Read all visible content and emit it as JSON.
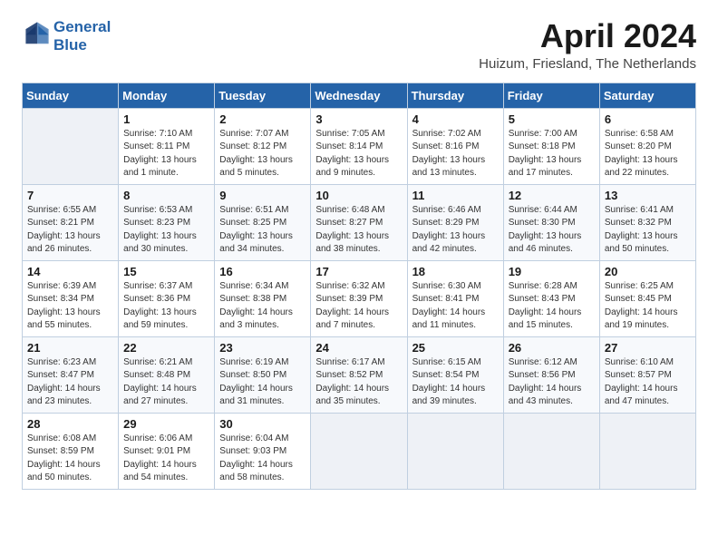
{
  "header": {
    "logo_line1": "General",
    "logo_line2": "Blue",
    "title": "April 2024",
    "subtitle": "Huizum, Friesland, The Netherlands"
  },
  "days_of_week": [
    "Sunday",
    "Monday",
    "Tuesday",
    "Wednesday",
    "Thursday",
    "Friday",
    "Saturday"
  ],
  "weeks": [
    [
      {
        "day": "",
        "info": ""
      },
      {
        "day": "1",
        "info": "Sunrise: 7:10 AM\nSunset: 8:11 PM\nDaylight: 13 hours\nand 1 minute."
      },
      {
        "day": "2",
        "info": "Sunrise: 7:07 AM\nSunset: 8:12 PM\nDaylight: 13 hours\nand 5 minutes."
      },
      {
        "day": "3",
        "info": "Sunrise: 7:05 AM\nSunset: 8:14 PM\nDaylight: 13 hours\nand 9 minutes."
      },
      {
        "day": "4",
        "info": "Sunrise: 7:02 AM\nSunset: 8:16 PM\nDaylight: 13 hours\nand 13 minutes."
      },
      {
        "day": "5",
        "info": "Sunrise: 7:00 AM\nSunset: 8:18 PM\nDaylight: 13 hours\nand 17 minutes."
      },
      {
        "day": "6",
        "info": "Sunrise: 6:58 AM\nSunset: 8:20 PM\nDaylight: 13 hours\nand 22 minutes."
      }
    ],
    [
      {
        "day": "7",
        "info": "Sunrise: 6:55 AM\nSunset: 8:21 PM\nDaylight: 13 hours\nand 26 minutes."
      },
      {
        "day": "8",
        "info": "Sunrise: 6:53 AM\nSunset: 8:23 PM\nDaylight: 13 hours\nand 30 minutes."
      },
      {
        "day": "9",
        "info": "Sunrise: 6:51 AM\nSunset: 8:25 PM\nDaylight: 13 hours\nand 34 minutes."
      },
      {
        "day": "10",
        "info": "Sunrise: 6:48 AM\nSunset: 8:27 PM\nDaylight: 13 hours\nand 38 minutes."
      },
      {
        "day": "11",
        "info": "Sunrise: 6:46 AM\nSunset: 8:29 PM\nDaylight: 13 hours\nand 42 minutes."
      },
      {
        "day": "12",
        "info": "Sunrise: 6:44 AM\nSunset: 8:30 PM\nDaylight: 13 hours\nand 46 minutes."
      },
      {
        "day": "13",
        "info": "Sunrise: 6:41 AM\nSunset: 8:32 PM\nDaylight: 13 hours\nand 50 minutes."
      }
    ],
    [
      {
        "day": "14",
        "info": "Sunrise: 6:39 AM\nSunset: 8:34 PM\nDaylight: 13 hours\nand 55 minutes."
      },
      {
        "day": "15",
        "info": "Sunrise: 6:37 AM\nSunset: 8:36 PM\nDaylight: 13 hours\nand 59 minutes."
      },
      {
        "day": "16",
        "info": "Sunrise: 6:34 AM\nSunset: 8:38 PM\nDaylight: 14 hours\nand 3 minutes."
      },
      {
        "day": "17",
        "info": "Sunrise: 6:32 AM\nSunset: 8:39 PM\nDaylight: 14 hours\nand 7 minutes."
      },
      {
        "day": "18",
        "info": "Sunrise: 6:30 AM\nSunset: 8:41 PM\nDaylight: 14 hours\nand 11 minutes."
      },
      {
        "day": "19",
        "info": "Sunrise: 6:28 AM\nSunset: 8:43 PM\nDaylight: 14 hours\nand 15 minutes."
      },
      {
        "day": "20",
        "info": "Sunrise: 6:25 AM\nSunset: 8:45 PM\nDaylight: 14 hours\nand 19 minutes."
      }
    ],
    [
      {
        "day": "21",
        "info": "Sunrise: 6:23 AM\nSunset: 8:47 PM\nDaylight: 14 hours\nand 23 minutes."
      },
      {
        "day": "22",
        "info": "Sunrise: 6:21 AM\nSunset: 8:48 PM\nDaylight: 14 hours\nand 27 minutes."
      },
      {
        "day": "23",
        "info": "Sunrise: 6:19 AM\nSunset: 8:50 PM\nDaylight: 14 hours\nand 31 minutes."
      },
      {
        "day": "24",
        "info": "Sunrise: 6:17 AM\nSunset: 8:52 PM\nDaylight: 14 hours\nand 35 minutes."
      },
      {
        "day": "25",
        "info": "Sunrise: 6:15 AM\nSunset: 8:54 PM\nDaylight: 14 hours\nand 39 minutes."
      },
      {
        "day": "26",
        "info": "Sunrise: 6:12 AM\nSunset: 8:56 PM\nDaylight: 14 hours\nand 43 minutes."
      },
      {
        "day": "27",
        "info": "Sunrise: 6:10 AM\nSunset: 8:57 PM\nDaylight: 14 hours\nand 47 minutes."
      }
    ],
    [
      {
        "day": "28",
        "info": "Sunrise: 6:08 AM\nSunset: 8:59 PM\nDaylight: 14 hours\nand 50 minutes."
      },
      {
        "day": "29",
        "info": "Sunrise: 6:06 AM\nSunset: 9:01 PM\nDaylight: 14 hours\nand 54 minutes."
      },
      {
        "day": "30",
        "info": "Sunrise: 6:04 AM\nSunset: 9:03 PM\nDaylight: 14 hours\nand 58 minutes."
      },
      {
        "day": "",
        "info": ""
      },
      {
        "day": "",
        "info": ""
      },
      {
        "day": "",
        "info": ""
      },
      {
        "day": "",
        "info": ""
      }
    ]
  ]
}
